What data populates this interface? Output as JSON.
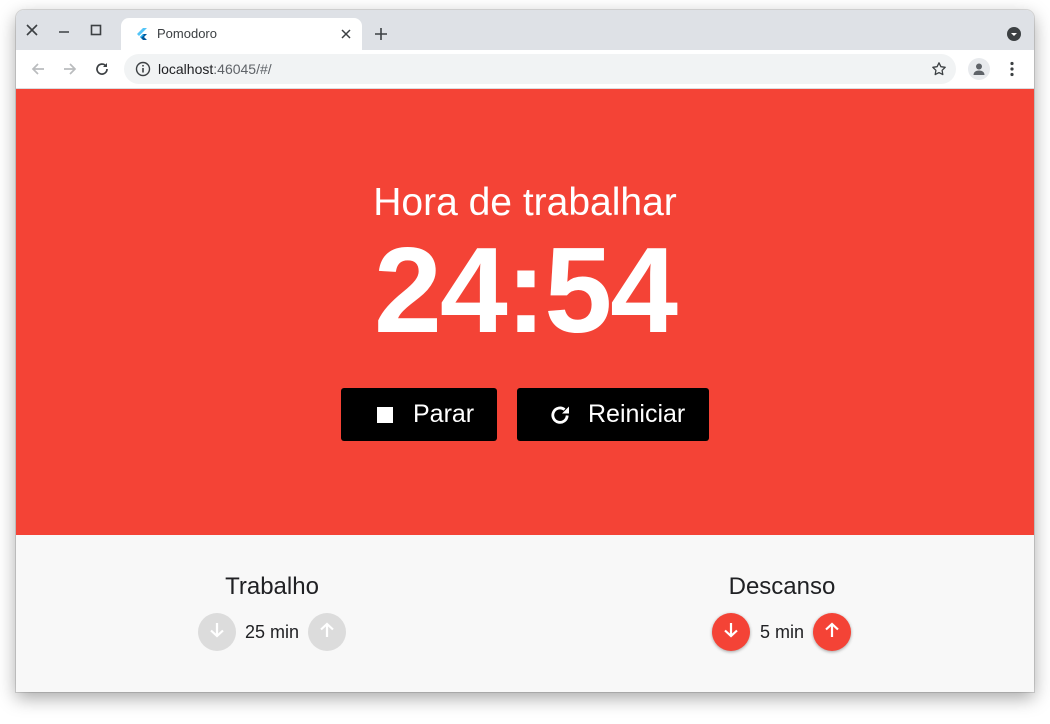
{
  "browser": {
    "tab_title": "Pomodoro",
    "url_host": "localhost",
    "url_rest": ":46045/#/"
  },
  "colors": {
    "accent": "#f44336",
    "button_bg": "#000000",
    "disabled": "#dcdcdc"
  },
  "timer": {
    "mode_title": "Hora de trabalhar",
    "time": "24:54",
    "stop_label": "Parar",
    "restart_label": "Reiniciar"
  },
  "settings": {
    "work": {
      "title": "Trabalho",
      "value": "25 min"
    },
    "rest": {
      "title": "Descanso",
      "value": "5 min"
    }
  },
  "icons": {
    "stop": "stop-icon",
    "restart": "refresh-icon",
    "decrease": "arrow-down-icon",
    "increase": "arrow-up-icon"
  }
}
